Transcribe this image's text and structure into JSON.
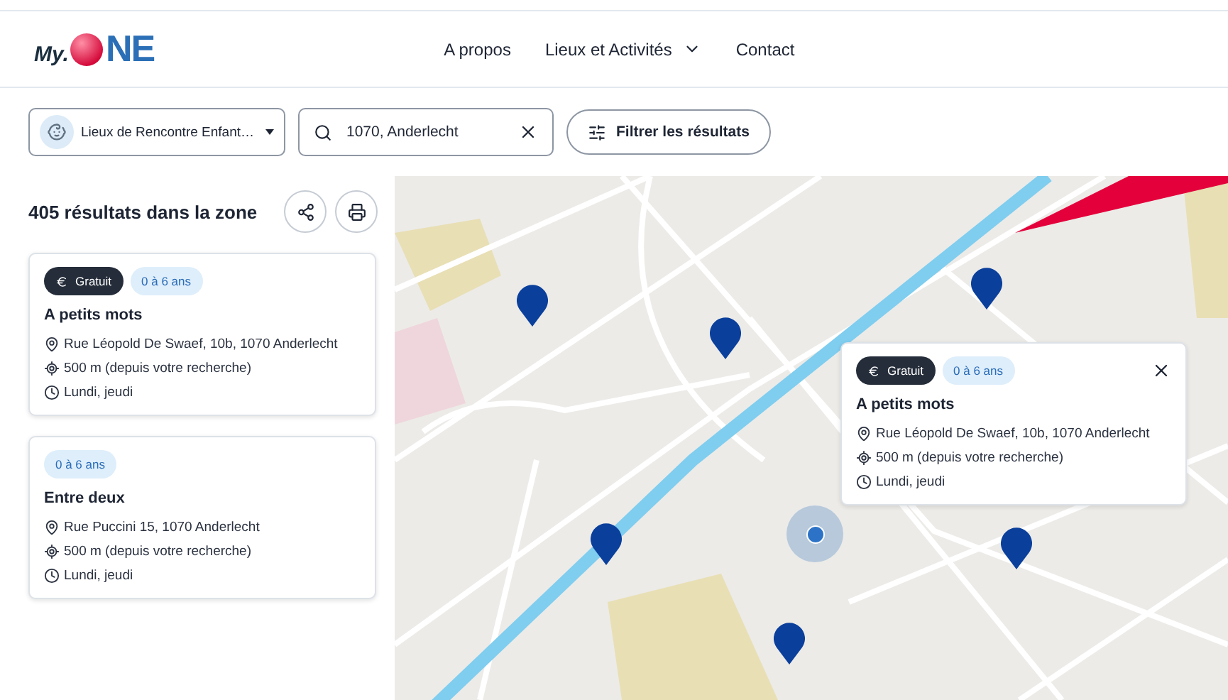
{
  "header": {
    "logo": {
      "prefix": "My.",
      "suffix": "NE"
    },
    "nav": [
      {
        "label": "A propos",
        "dropdown": false
      },
      {
        "label": "Lieux et Activités",
        "dropdown": true
      },
      {
        "label": "Contact",
        "dropdown": false
      }
    ]
  },
  "filters": {
    "category": {
      "value": "Lieux de Rencontre Enfant…"
    },
    "search": {
      "value": "1070, Anderlecht"
    },
    "filter_button": "Filtrer les résultats"
  },
  "results": {
    "title": "405 résultats dans la zone",
    "items": [
      {
        "tags": [
          {
            "kind": "price",
            "label": "Gratuit"
          },
          {
            "kind": "age",
            "label": "0 à 6 ans"
          }
        ],
        "name": "A petits mots",
        "address": "Rue Léopold De Swaef, 10b, 1070 Anderlecht",
        "distance": "500 m (depuis votre recherche)",
        "schedule": "Lundi, jeudi"
      },
      {
        "tags": [
          {
            "kind": "age",
            "label": "0 à 6 ans"
          }
        ],
        "name": "Entre deux",
        "address": "Rue Puccini 15, 1070 Anderlecht",
        "distance": "500 m (depuis votre recherche)",
        "schedule": "Lundi, jeudi"
      }
    ]
  },
  "map": {
    "popup": {
      "tags": [
        {
          "kind": "price",
          "label": "Gratuit"
        },
        {
          "kind": "age",
          "label": "0 à 6 ans"
        }
      ],
      "name": "A petits mots",
      "address": "Rue Léopold De Swaef, 10b, 1070 Anderlecht",
      "distance": "500 m (depuis votre recherche)",
      "schedule": "Lundi, jeudi"
    }
  }
}
